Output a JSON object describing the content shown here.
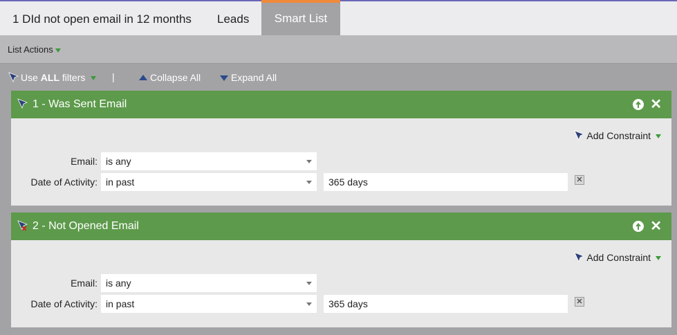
{
  "tabs": [
    {
      "label": "1 DId not open email in 12 months"
    },
    {
      "label": "Leads"
    },
    {
      "label": "Smart List"
    }
  ],
  "list_actions": {
    "label": "List Actions"
  },
  "toolbar": {
    "use_prefix": "Use ",
    "use_bold": "ALL",
    "use_suffix": " filters",
    "separator": "|",
    "collapse_label": "Collapse All",
    "expand_label": "Expand All"
  },
  "filters": [
    {
      "title": "1 - Was Sent Email",
      "add_constraint": "Add Constraint",
      "rows": [
        {
          "label": "Email:",
          "select_value": "is any"
        },
        {
          "label": "Date of Activity:",
          "select_value": "in past",
          "input_value": "365 days"
        }
      ]
    },
    {
      "title": "2 - Not Opened Email",
      "add_constraint": "Add Constraint",
      "rows": [
        {
          "label": "Email:",
          "select_value": "is any"
        },
        {
          "label": "Date of Activity:",
          "select_value": "in past",
          "input_value": "365 days"
        }
      ]
    }
  ],
  "colors": {
    "card_header": "#5d9a4b",
    "active_tab_accent": "#f08a3a",
    "background": "#a3a3a6"
  }
}
